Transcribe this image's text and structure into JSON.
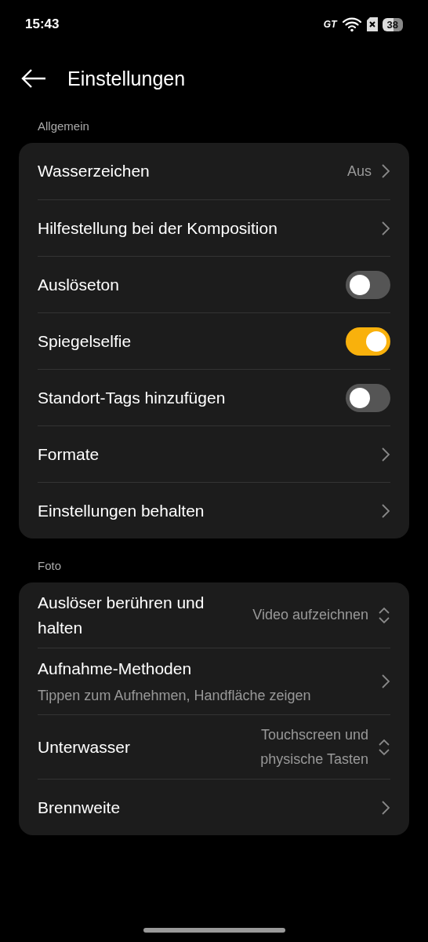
{
  "status_bar": {
    "time": "15:43",
    "network": "GT",
    "battery": "38"
  },
  "header": {
    "title": "Einstellungen"
  },
  "sections": [
    {
      "label": "Allgemein",
      "rows": [
        {
          "kind": "link",
          "title": "Wasserzeichen",
          "value": "Aus"
        },
        {
          "kind": "link",
          "title": "Hilfestellung bei der Komposition"
        },
        {
          "kind": "toggle",
          "title": "Auslöseton",
          "on": false
        },
        {
          "kind": "toggle",
          "title": "Spiegelselfie",
          "on": true
        },
        {
          "kind": "toggle",
          "title": "Standort-Tags hinzufügen",
          "on": false
        },
        {
          "kind": "link",
          "title": "Formate"
        },
        {
          "kind": "link",
          "title": "Einstellungen behalten"
        }
      ]
    },
    {
      "label": "Foto",
      "rows": [
        {
          "kind": "select",
          "title": "Auslöser berühren und halten",
          "value": "Video aufzeichnen"
        },
        {
          "kind": "link",
          "title": "Aufnahme-Methoden",
          "subtitle": "Tippen zum Aufnehmen, Handfläche zeigen"
        },
        {
          "kind": "select",
          "title": "Unterwasser",
          "value": "Touchscreen und physische Tasten"
        },
        {
          "kind": "link",
          "title": "Brennweite"
        }
      ]
    }
  ]
}
